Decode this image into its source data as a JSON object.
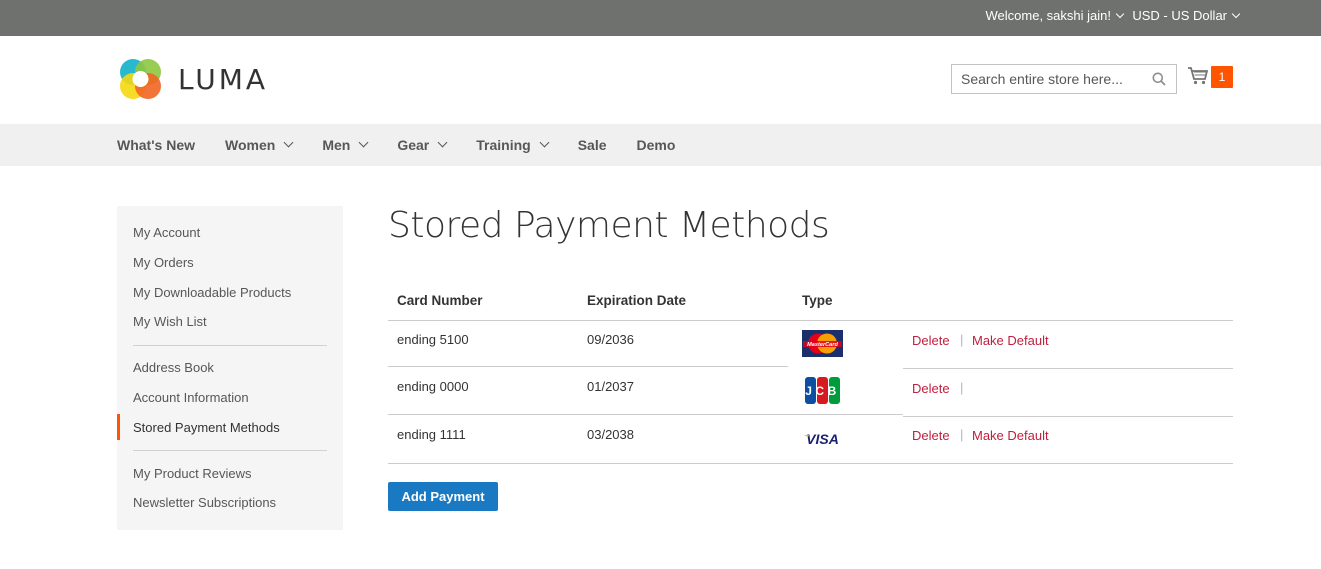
{
  "header": {
    "welcome": "Welcome, sakshi jain!",
    "currency": "USD - US Dollar",
    "logo_text": "LUMA",
    "search_placeholder": "Search entire store here...",
    "cart_count": "1"
  },
  "nav": {
    "items": [
      {
        "label": "What's New"
      },
      {
        "label": "Women"
      },
      {
        "label": "Men"
      },
      {
        "label": "Gear"
      },
      {
        "label": "Training"
      },
      {
        "label": "Sale"
      },
      {
        "label": "Demo"
      }
    ]
  },
  "sidebar": {
    "items": [
      "My Account",
      "My Orders",
      "My Downloadable Products",
      "My Wish List",
      "Address Book",
      "Account Information",
      "Stored Payment Methods",
      "My Product Reviews",
      "Newsletter Subscriptions"
    ]
  },
  "page": {
    "title": "Stored Payment Methods",
    "headers": {
      "card": "Card Number",
      "exp": "Expiration Date",
      "type": "Type"
    },
    "rows": [
      {
        "card": "ending 5100",
        "exp": "09/2036",
        "type_icon": "mastercard-icon",
        "delete": "Delete",
        "default": "Make Default"
      },
      {
        "card": "ending 0000",
        "exp": "01/2037",
        "type_icon": "jcb-icon",
        "delete": "Delete",
        "default": ""
      },
      {
        "card": "ending 1111",
        "exp": "03/2038",
        "type_icon": "visa-icon",
        "delete": "Delete",
        "default": "Make Default"
      }
    ],
    "separator": "|",
    "mastercard_text": "MasterCard",
    "jcb_text": "JCB",
    "visa_text": "VISA",
    "add_button": "Add Payment"
  },
  "colors": {
    "topbar": "#6e716e",
    "accent": "#ff5501",
    "link": "#c0203e",
    "button": "#1979c3"
  }
}
